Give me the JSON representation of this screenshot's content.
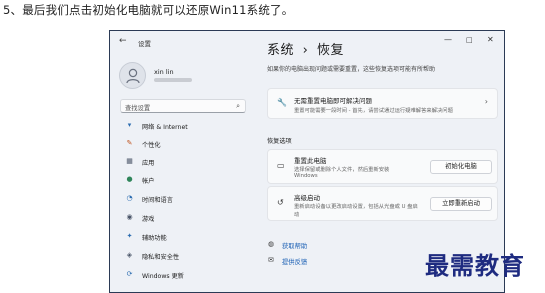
{
  "caption": "5、最后我们点击初始化电脑就可以还原Win11系统了。",
  "window": {
    "back_icon": "←",
    "app_title": "设置",
    "controls": {
      "minimize": "—",
      "maximize": "□",
      "close": "✕"
    }
  },
  "sidebar": {
    "user_name": "xin lin",
    "search_placeholder": "查找设置",
    "search_icon": "⌕",
    "items": [
      {
        "label": "网络 & Internet",
        "icon": "▾",
        "icon_color": "#2b6cb0"
      },
      {
        "label": "个性化",
        "icon": "✎",
        "icon_color": "#c05621"
      },
      {
        "label": "应用",
        "icon": "▦",
        "icon_color": "#4a5568"
      },
      {
        "label": "帐户",
        "icon": "●",
        "icon_color": "#2f855a"
      },
      {
        "label": "时间和语言",
        "icon": "◔",
        "icon_color": "#2b6cb0"
      },
      {
        "label": "游戏",
        "icon": "◉",
        "icon_color": "#4a5568"
      },
      {
        "label": "辅助功能",
        "icon": "✦",
        "icon_color": "#2b6cb0"
      },
      {
        "label": "隐私和安全性",
        "icon": "◈",
        "icon_color": "#4a5568"
      },
      {
        "label": "Windows 更新",
        "icon": "⟳",
        "icon_color": "#2b6cb0"
      }
    ]
  },
  "main": {
    "breadcrumb_parent": "系统",
    "breadcrumb_sep": "›",
    "breadcrumb_current": "恢复",
    "description": "如果你的电脑出现问题或需要重置，这些恢复选项可能有所帮助",
    "troubleshoot_card": {
      "icon": "🔧",
      "title": "无需重置电脑即可解决问题",
      "subtitle": "重置可能需要一段时间 - 首先，请尝试通过运行疑难解答来解决问题",
      "chevron": "›"
    },
    "section_label": "恢复选项",
    "reset_card": {
      "icon": "▭",
      "title": "重置此电脑",
      "subtitle_1": "选择保留或删除个人文件，然后重新安装",
      "subtitle_2": "Windows",
      "button": "初始化电脑"
    },
    "advanced_card": {
      "icon": "↺",
      "title": "高级启动",
      "subtitle_1": "重新启动设备以更改启动设置，包括从光盘或 U 盘启",
      "subtitle_2": "动",
      "button": "立即重新启动"
    },
    "links": [
      {
        "icon": "◍",
        "label": "获取帮助"
      },
      {
        "icon": "✉",
        "label": "提供反馈"
      }
    ]
  },
  "watermark": "最需教育"
}
